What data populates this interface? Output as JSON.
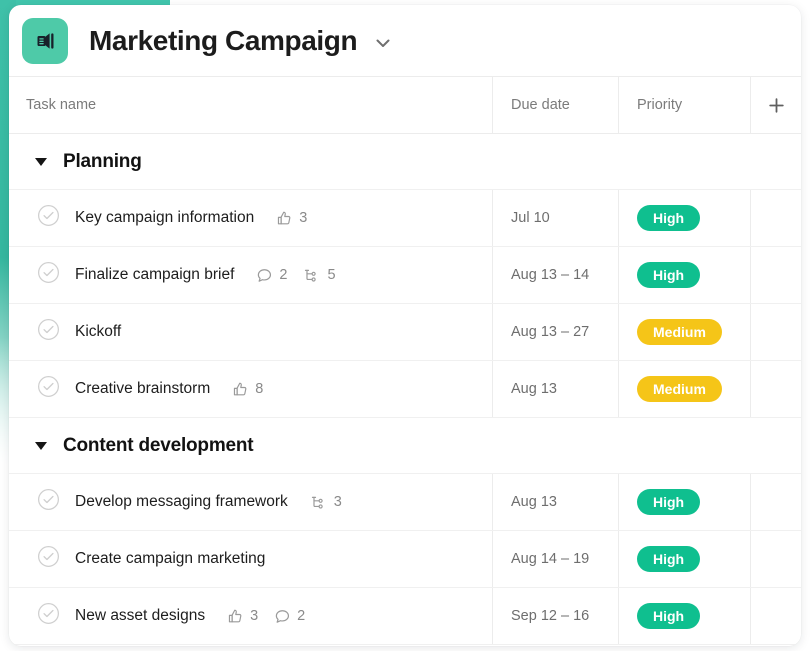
{
  "theme": {
    "accent": "#41c6ad",
    "icon_bg": "#4ecaa8",
    "priority_high": "#0fbf8f",
    "priority_medium": "#f5c518"
  },
  "header": {
    "project_icon": "megaphone-icon",
    "title": "Marketing Campaign",
    "dropdown_icon": "chevron-down-icon"
  },
  "table": {
    "columns": [
      {
        "key": "task",
        "label": "Task name"
      },
      {
        "key": "due",
        "label": "Due date"
      },
      {
        "key": "priority",
        "label": "Priority"
      }
    ],
    "add_column_icon": "plus-icon",
    "sections": [
      {
        "title": "Planning",
        "collapse_icon": "caret-down-icon",
        "tasks": [
          {
            "name": "Key campaign information",
            "due": "Jul 10",
            "priority": "High",
            "priority_level": "high",
            "meta": [
              {
                "icon": "thumbs-up-icon",
                "count": "3"
              }
            ]
          },
          {
            "name": "Finalize campaign brief",
            "due": "Aug 13 – 14",
            "priority": "High",
            "priority_level": "high",
            "meta": [
              {
                "icon": "comment-icon",
                "count": "2"
              },
              {
                "icon": "subtask-icon",
                "count": "5"
              }
            ]
          },
          {
            "name": "Kickoff",
            "due": "Aug 13 – 27",
            "priority": "Medium",
            "priority_level": "medium",
            "meta": []
          },
          {
            "name": "Creative brainstorm",
            "due": "Aug 13",
            "priority": "Medium",
            "priority_level": "medium",
            "meta": [
              {
                "icon": "thumbs-up-icon",
                "count": "8"
              }
            ]
          }
        ]
      },
      {
        "title": "Content development",
        "collapse_icon": "caret-down-icon",
        "tasks": [
          {
            "name": "Develop messaging framework",
            "due": "Aug 13",
            "priority": "High",
            "priority_level": "high",
            "meta": [
              {
                "icon": "subtask-icon",
                "count": "3"
              }
            ]
          },
          {
            "name": "Create campaign marketing",
            "due": "Aug 14 – 19",
            "priority": "High",
            "priority_level": "high",
            "meta": []
          },
          {
            "name": "New asset designs",
            "due": "Sep 12 – 16",
            "priority": "High",
            "priority_level": "high",
            "meta": [
              {
                "icon": "thumbs-up-icon",
                "count": "3"
              },
              {
                "icon": "comment-icon",
                "count": "2"
              }
            ]
          }
        ]
      }
    ]
  }
}
